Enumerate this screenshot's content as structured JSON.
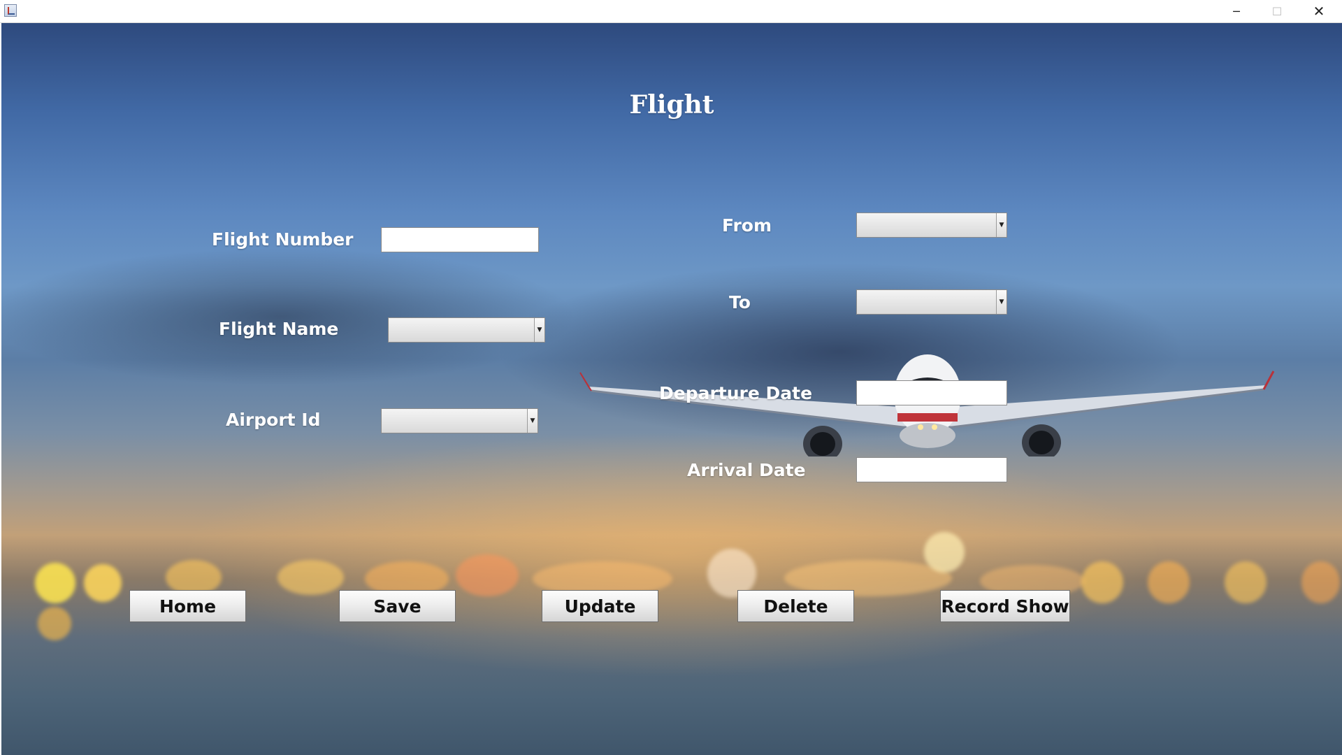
{
  "window": {
    "minimize_glyph": "─",
    "maximize_glyph": "☐",
    "close_glyph": "✕"
  },
  "form": {
    "title": "Flight",
    "flight_number_label": "Flight Number",
    "flight_number_value": "",
    "flight_name_label": "Flight Name",
    "flight_name_value": "",
    "airport_id_label": "Airport Id",
    "airport_id_value": "",
    "from_label": "From",
    "from_value": "",
    "to_label": "To",
    "to_value": "",
    "departure_date_label": "Departure Date",
    "departure_date_value": "",
    "arrival_date_label": "Arrival Date",
    "arrival_date_value": "",
    "dropdown_arrow": "▼"
  },
  "buttons": {
    "home": "Home",
    "save": "Save",
    "update": "Update",
    "delete": "Delete",
    "record_show": "Record Show"
  }
}
